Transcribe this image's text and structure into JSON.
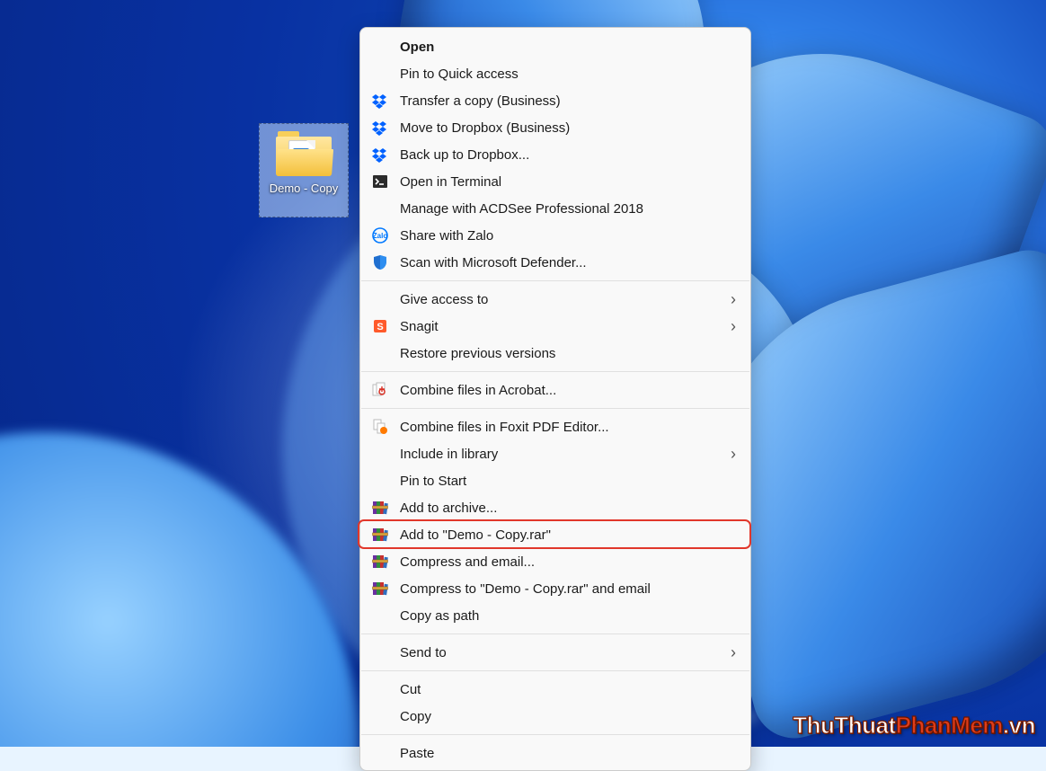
{
  "desktop": {
    "icon_label": "Demo - Copy"
  },
  "menu": {
    "items": [
      {
        "label": "Open",
        "icon": "none",
        "bold": true
      },
      {
        "label": "Pin to Quick access",
        "icon": "none"
      },
      {
        "label": "Transfer a copy (Business)",
        "icon": "dropbox"
      },
      {
        "label": "Move to Dropbox (Business)",
        "icon": "dropbox"
      },
      {
        "label": "Back up to Dropbox...",
        "icon": "dropbox"
      },
      {
        "label": "Open in Terminal",
        "icon": "terminal"
      },
      {
        "label": "Manage with ACDSee Professional 2018",
        "icon": "none"
      },
      {
        "label": "Share with Zalo",
        "icon": "zalo"
      },
      {
        "label": "Scan with Microsoft Defender...",
        "icon": "defender"
      },
      {
        "sep": true
      },
      {
        "label": "Give access to",
        "icon": "none",
        "submenu": true
      },
      {
        "label": "Snagit",
        "icon": "snagit",
        "submenu": true
      },
      {
        "label": "Restore previous versions",
        "icon": "none"
      },
      {
        "sep": true
      },
      {
        "label": "Combine files in Acrobat...",
        "icon": "acrobat"
      },
      {
        "sep": true
      },
      {
        "label": "Combine files in Foxit PDF Editor...",
        "icon": "foxit"
      },
      {
        "label": "Include in library",
        "icon": "none",
        "submenu": true
      },
      {
        "label": "Pin to Start",
        "icon": "none"
      },
      {
        "label": "Add to archive...",
        "icon": "winrar"
      },
      {
        "label": "Add to \"Demo - Copy.rar\"",
        "icon": "winrar",
        "highlighted": true
      },
      {
        "label": "Compress and email...",
        "icon": "winrar"
      },
      {
        "label": "Compress to \"Demo - Copy.rar\" and email",
        "icon": "winrar"
      },
      {
        "label": "Copy as path",
        "icon": "none"
      },
      {
        "sep": true
      },
      {
        "label": "Send to",
        "icon": "none",
        "submenu": true
      },
      {
        "sep": true
      },
      {
        "label": "Cut",
        "icon": "none"
      },
      {
        "label": "Copy",
        "icon": "none"
      },
      {
        "sep": true
      },
      {
        "label": "Paste",
        "icon": "none"
      }
    ]
  },
  "watermark": {
    "part1": "ThuThuat",
    "part2": "PhanMem",
    "part3": ".vn"
  }
}
